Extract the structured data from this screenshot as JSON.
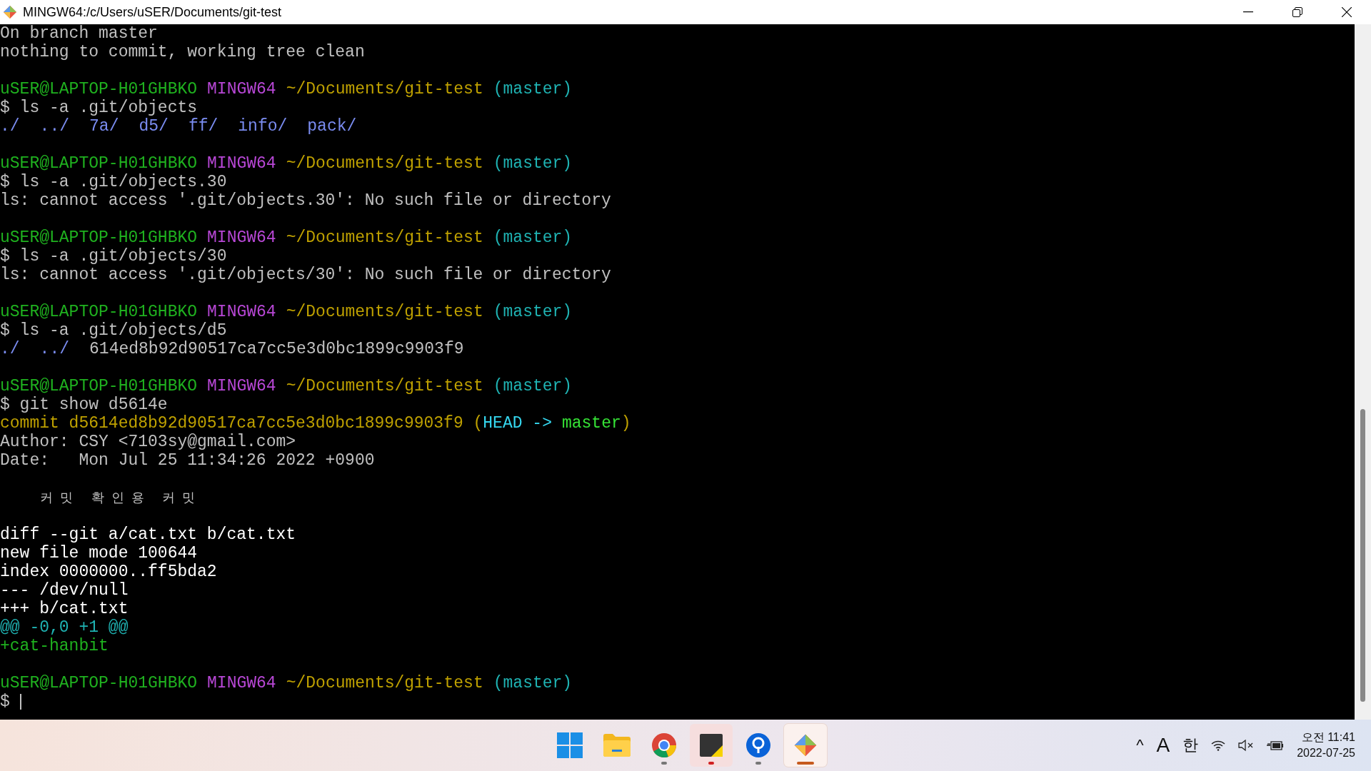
{
  "window": {
    "title": "MINGW64:/c/Users/uSER/Documents/git-test"
  },
  "terminal": {
    "blocks": [
      {
        "lines": [
          {
            "segments": [
              {
                "text": "On branch master",
                "kind": "plain"
              }
            ]
          },
          {
            "segments": [
              {
                "text": "nothing to commit, working tree clean",
                "kind": "plain"
              }
            ]
          }
        ]
      },
      {
        "lines": [
          {
            "segments": [
              {
                "text": "uSER@LAPTOP-H01GHBKO",
                "kind": "user"
              },
              {
                "text": "MINGW64",
                "kind": "host"
              },
              {
                "text": "~/Documents/git-test",
                "kind": "path"
              },
              {
                "text": "(master)",
                "kind": "branch"
              }
            ]
          },
          {
            "segments": [
              {
                "text": "$ ls -a .git/objects",
                "kind": "plain"
              }
            ]
          },
          {
            "segments": [
              {
                "text": "./",
                "kind": "dir"
              },
              {
                "text": "../",
                "kind": "dir"
              },
              {
                "text": "7a/",
                "kind": "dir"
              },
              {
                "text": "d5/",
                "kind": "dir"
              },
              {
                "text": "ff/",
                "kind": "dir"
              },
              {
                "text": "info/",
                "kind": "dir"
              },
              {
                "text": "pack/",
                "kind": "dir"
              }
            ]
          }
        ]
      },
      {
        "lines": [
          {
            "segments": [
              {
                "text": "uSER@LAPTOP-H01GHBKO",
                "kind": "user"
              },
              {
                "text": "MINGW64",
                "kind": "host"
              },
              {
                "text": "~/Documents/git-test",
                "kind": "path"
              },
              {
                "text": "(master)",
                "kind": "branch"
              }
            ]
          },
          {
            "segments": [
              {
                "text": "$ ls -a .git/objects.30",
                "kind": "plain"
              }
            ]
          },
          {
            "segments": [
              {
                "text": "ls: cannot access '.git/objects.30': No such file or directory",
                "kind": "plain"
              }
            ]
          }
        ]
      },
      {
        "lines": [
          {
            "segments": [
              {
                "text": "uSER@LAPTOP-H01GHBKO",
                "kind": "user"
              },
              {
                "text": "MINGW64",
                "kind": "host"
              },
              {
                "text": "~/Documents/git-test",
                "kind": "path"
              },
              {
                "text": "(master)",
                "kind": "branch"
              }
            ]
          },
          {
            "segments": [
              {
                "text": "$ ls -a .git/objects/30",
                "kind": "plain"
              }
            ]
          },
          {
            "segments": [
              {
                "text": "ls: cannot access '.git/objects/30': No such file or directory",
                "kind": "plain"
              }
            ]
          }
        ]
      },
      {
        "lines": [
          {
            "segments": [
              {
                "text": "uSER@LAPTOP-H01GHBKO",
                "kind": "user"
              },
              {
                "text": "MINGW64",
                "kind": "host"
              },
              {
                "text": "~/Documents/git-test",
                "kind": "path"
              },
              {
                "text": "(master)",
                "kind": "branch"
              }
            ]
          },
          {
            "segments": [
              {
                "text": "$ ls -a .git/objects/d5",
                "kind": "plain"
              }
            ]
          },
          {
            "segments": [
              {
                "text": "./",
                "kind": "dir"
              },
              {
                "text": "../",
                "kind": "dir"
              },
              {
                "text": "614ed8b92d90517ca7cc5e3d0bc1899c9903f9",
                "kind": "plain"
              }
            ]
          }
        ]
      },
      {
        "lines": [
          {
            "segments": [
              {
                "text": "uSER@LAPTOP-H01GHBKO",
                "kind": "user"
              },
              {
                "text": "MINGW64",
                "kind": "host"
              },
              {
                "text": "~/Documents/git-test",
                "kind": "path"
              },
              {
                "text": "(master)",
                "kind": "branch"
              }
            ]
          },
          {
            "segments": [
              {
                "text": "$ git show d5614e",
                "kind": "plain"
              }
            ]
          },
          {
            "segments": [
              {
                "text": "commit d5614ed8b92d90517ca7cc5e3d0bc1899c9903f9 (",
                "kind": "commit"
              },
              {
                "text": "HEAD ->",
                "kind": "head"
              },
              {
                "text": "master",
                "kind": "ref"
              },
              {
                "text": ")",
                "kind": "commit"
              }
            ]
          },
          {
            "segments": [
              {
                "text": "Author: CSY <7103sy@gmail.com>",
                "kind": "plain"
              }
            ]
          },
          {
            "segments": [
              {
                "text": "Date:   Mon Jul 25 11:34:26 2022 +0900",
                "kind": "plain"
              }
            ]
          }
        ]
      },
      {
        "lines": [
          {
            "segments": [
              {
                "text": "커밋 확인용 커밋",
                "kind": "message"
              }
            ]
          }
        ]
      },
      {
        "lines": [
          {
            "segments": [
              {
                "text": "diff --git a/cat.txt b/cat.txt",
                "kind": "bright"
              }
            ]
          },
          {
            "segments": [
              {
                "text": "new file mode 100644",
                "kind": "bright"
              }
            ]
          },
          {
            "segments": [
              {
                "text": "index 0000000..ff5bda2",
                "kind": "bright"
              }
            ]
          },
          {
            "segments": [
              {
                "text": "--- /dev/null",
                "kind": "bright"
              }
            ]
          },
          {
            "segments": [
              {
                "text": "+++ b/cat.txt",
                "kind": "bright"
              }
            ]
          },
          {
            "segments": [
              {
                "text": "@@ -0,0 +1 @@",
                "kind": "hunk"
              }
            ]
          },
          {
            "segments": [
              {
                "text": "+cat-hanbit",
                "kind": "added"
              }
            ]
          }
        ]
      },
      {
        "lines": [
          {
            "segments": [
              {
                "text": "uSER@LAPTOP-H01GHBKO",
                "kind": "user"
              },
              {
                "text": "MINGW64",
                "kind": "host"
              },
              {
                "text": "~/Documents/git-test",
                "kind": "path"
              },
              {
                "text": "(master)",
                "kind": "branch"
              }
            ]
          }
        ]
      }
    ],
    "prompt": "$"
  },
  "taskbar": {
    "apps": [
      {
        "kind": "start",
        "open": false,
        "focused": false
      },
      {
        "kind": "folder",
        "open": false,
        "focused": false
      },
      {
        "kind": "browser",
        "open": true,
        "focused": false
      },
      {
        "kind": "note",
        "open": true,
        "focused": false
      },
      {
        "kind": "pin",
        "open": true,
        "focused": false
      },
      {
        "kind": "git",
        "open": true,
        "focused": true
      }
    ],
    "tray": {
      "caret": "^",
      "input_mode": "A",
      "ime": "한",
      "time": "오전 11:41",
      "date": "2022-07-25"
    }
  }
}
